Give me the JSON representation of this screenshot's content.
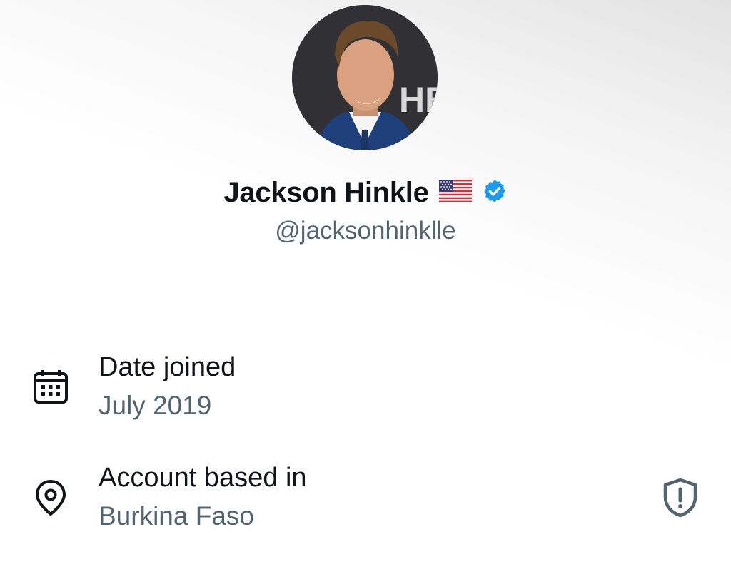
{
  "profile": {
    "display_name": "Jackson Hinkle",
    "handle": "@jacksonhinklle",
    "avatar_icon": "profile-photo",
    "flag_icon": "us-flag-emoji",
    "verified_icon": "verified-badge-icon",
    "verified_color": "#1d9bf0"
  },
  "about": {
    "joined": {
      "title": "Date joined",
      "value": "July 2019",
      "icon": "calendar-icon"
    },
    "location": {
      "title": "Account based in",
      "value": "Burkina Faso",
      "icon": "location-pin-icon",
      "warning_icon": "shield-alert-icon"
    }
  },
  "colors": {
    "primary_text": "#0f1419",
    "secondary_text": "#536471"
  }
}
